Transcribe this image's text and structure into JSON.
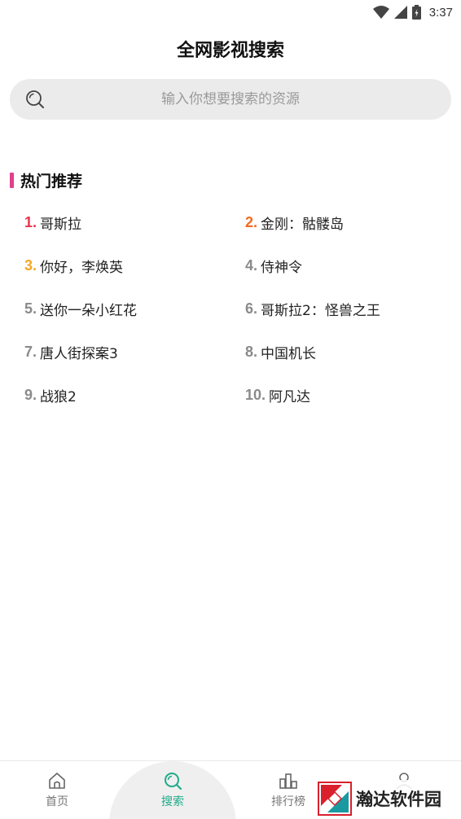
{
  "status": {
    "time": "3:37"
  },
  "page": {
    "title": "全网影视搜索"
  },
  "search": {
    "placeholder": "输入你想要搜索的资源"
  },
  "section": {
    "title": "热门推荐"
  },
  "colors": {
    "rank1": "#e8344e",
    "rank2": "#f26b1d",
    "rank3": "#f5a623",
    "accent": "#1fab89",
    "section_bar": "#e0408c"
  },
  "hot": [
    {
      "rank": "1.",
      "title": "哥斯拉"
    },
    {
      "rank": "2.",
      "title": "金刚：骷髅岛"
    },
    {
      "rank": "3.",
      "title": "你好，李焕英"
    },
    {
      "rank": "4.",
      "title": "侍神令"
    },
    {
      "rank": "5.",
      "title": "送你一朵小红花"
    },
    {
      "rank": "6.",
      "title": "哥斯拉2：怪兽之王"
    },
    {
      "rank": "7.",
      "title": "唐人街探案3"
    },
    {
      "rank": "8.",
      "title": "中国机长"
    },
    {
      "rank": "9.",
      "title": "战狼2"
    },
    {
      "rank": "10.",
      "title": "阿凡达"
    }
  ],
  "nav": [
    {
      "label": "首页",
      "icon": "home-icon"
    },
    {
      "label": "搜索",
      "icon": "search-icon"
    },
    {
      "label": "排行榜",
      "icon": "ranking-icon"
    },
    {
      "label": "",
      "icon": "user-icon"
    }
  ],
  "watermark": {
    "text": "瀚达软件园"
  }
}
